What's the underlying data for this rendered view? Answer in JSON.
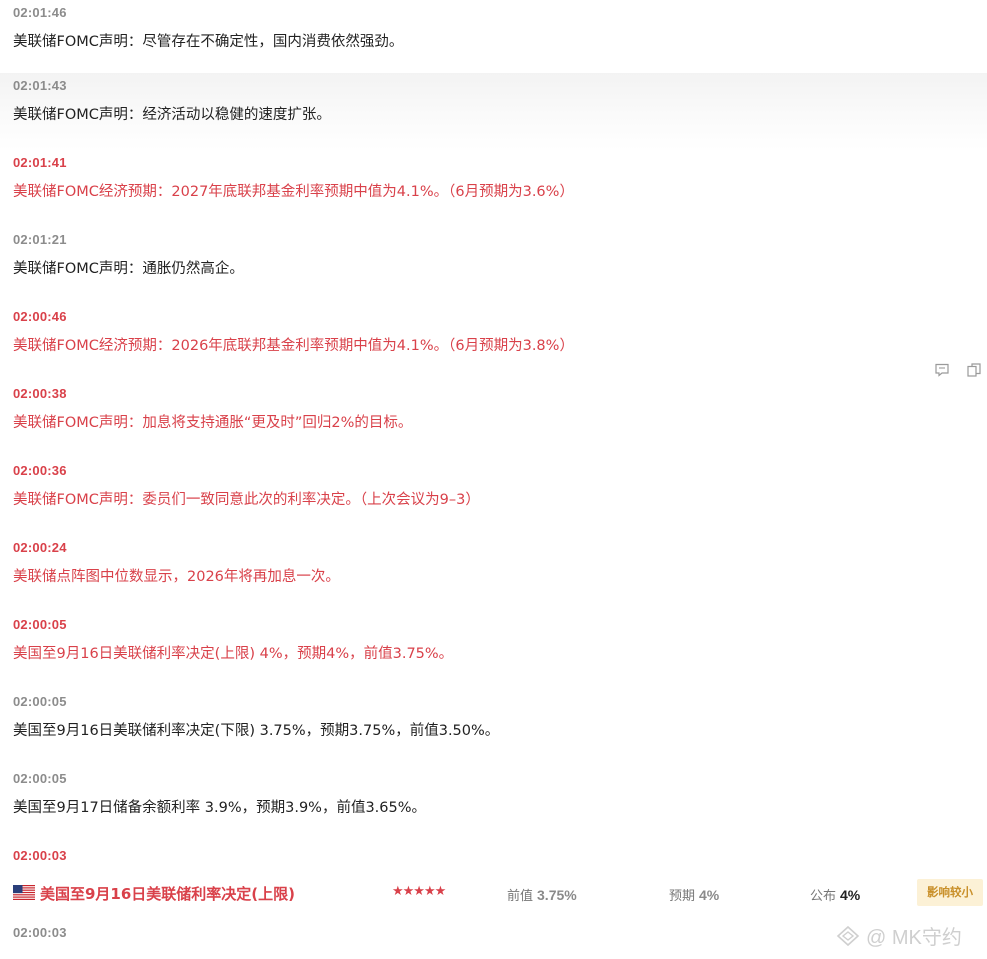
{
  "feed": [
    {
      "time": "02:01:46",
      "text": "美联储FOMC声明：尽管存在不确定性，国内消费依然强劲。",
      "important": false
    },
    {
      "time": "02:01:43",
      "text": "美联储FOMC声明：经济活动以稳健的速度扩张。",
      "important": false
    },
    {
      "time": "02:01:41",
      "text": "美联储FOMC经济预期：2027年底联邦基金利率预期中值为4.1%。（6月预期为3.6%）",
      "important": true
    },
    {
      "time": "02:01:21",
      "text": "美联储FOMC声明：通胀仍然高企。",
      "important": false
    },
    {
      "time": "02:00:46",
      "text": "美联储FOMC经济预期：2026年底联邦基金利率预期中值为4.1%。（6月预期为3.8%）",
      "important": true
    },
    {
      "time": "02:00:38",
      "text": "美联储FOMC声明：加息将支持通胀“更及时”回归2%的目标。",
      "important": true
    },
    {
      "time": "02:00:36",
      "text": "美联储FOMC声明：委员们一致同意此次的利率决定。（上次会议为9–3）",
      "important": true
    },
    {
      "time": "02:00:24",
      "text": "美联储点阵图中位数显示，2026年将再加息一次。",
      "important": true
    },
    {
      "time": "02:00:05",
      "text": "美国至9月16日美联储利率决定(上限) 4%，预期4%，前值3.75%。",
      "important": true
    },
    {
      "time": "02:00:05",
      "text": "美国至9月16日美联储利率决定(下限) 3.75%，预期3.75%，前值3.50%。",
      "important": false
    },
    {
      "time": "02:00:05",
      "text": "美国至9月17日储备余额利率 3.9%，预期3.9%，前值3.65%。",
      "important": false
    },
    {
      "time": "02:00:03",
      "text": "",
      "important": true
    },
    {
      "time": "02:00:03",
      "text": "",
      "important": false
    }
  ],
  "data_row": {
    "name": "美国至9月16日美联储利率决定(上限)",
    "stars": "★★★★★",
    "rating": 5,
    "previous_label": "前值",
    "previous_value": "3.75%",
    "forecast_label": "预期",
    "forecast_value": "4%",
    "actual_label": "公布",
    "actual_value": "4%",
    "impact_badge": "影响较小",
    "flag_icon": "us-flag-icon"
  },
  "tools": [
    "comment-icon",
    "copy-icon"
  ],
  "watermark": "@ MK守约",
  "colors": {
    "important": "#d9414a",
    "normal": "#222222",
    "time": "#8c8c8c",
    "badge_bg": "#fcf1d6",
    "badge_text": "#c9902a"
  }
}
